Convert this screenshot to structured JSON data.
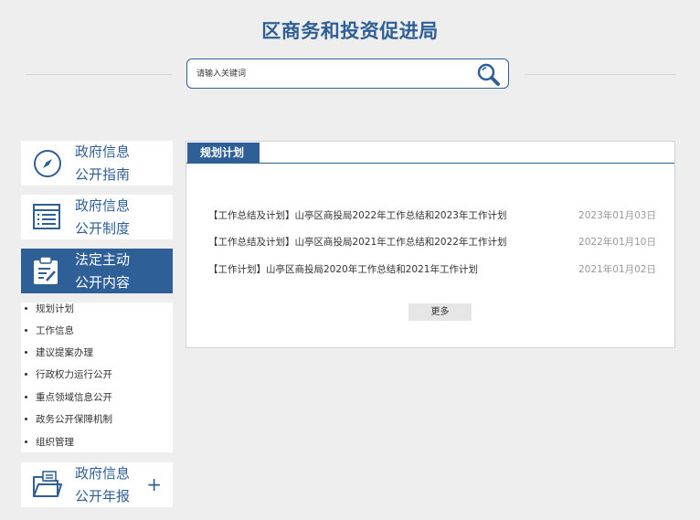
{
  "header": {
    "title": "区商务和投资促进局"
  },
  "search": {
    "placeholder": "请输入关键词",
    "button_icon": "search-icon"
  },
  "sidebar": {
    "items": [
      {
        "line1": "政府信息",
        "line2": "公开指南",
        "icon": "compass-icon",
        "active": false
      },
      {
        "line1": "政府信息",
        "line2": "公开制度",
        "icon": "list-document-icon",
        "active": false
      },
      {
        "line1": "法定主动",
        "line2": "公开内容",
        "icon": "clipboard-edit-icon",
        "active": true
      },
      {
        "line1": "政府信息",
        "line2": "公开年报",
        "icon": "folder-document-icon",
        "active": false,
        "expand": "+"
      }
    ],
    "submenu": [
      "规划计划",
      "工作信息",
      "建议提案办理",
      "行政权力运行公开",
      "重点领域信息公开",
      "政务公开保障机制",
      "组织管理"
    ]
  },
  "panel": {
    "tab_label": "规划计划",
    "news": [
      {
        "title": "【工作总结及计划】山亭区商投局2022年工作总结和2023年工作计划",
        "date": "2023年01月03日"
      },
      {
        "title": "【工作总结及计划】山亭区商投局2021年工作总结和2022年工作计划",
        "date": "2022年01月10日"
      },
      {
        "title": "【工作计划】山亭区商投局2020年工作总结和2021年工作计划",
        "date": "2021年01月02日"
      }
    ],
    "more_label": "更多"
  },
  "colors": {
    "brand": "#2e5f97",
    "background": "#eeeeee",
    "date_text": "#999999"
  }
}
